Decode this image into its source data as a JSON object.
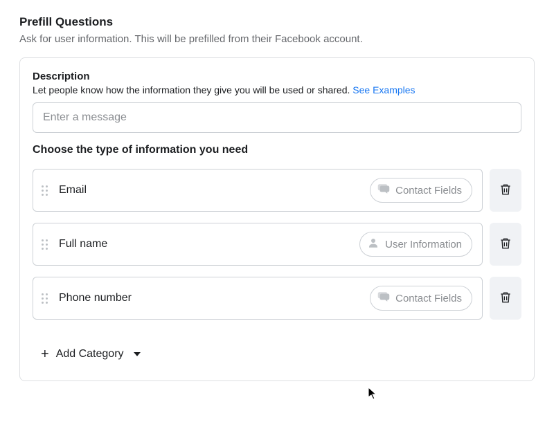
{
  "header": {
    "title": "Prefill Questions",
    "subtitle": "Ask for user information. This will be prefilled from their Facebook account."
  },
  "description": {
    "label": "Description",
    "help": "Let people know how the information they give you will be used or shared.",
    "examples_link": "See Examples",
    "placeholder": "Enter a message",
    "value": ""
  },
  "choose_label": "Choose the type of information you need",
  "fields": [
    {
      "name": "Email",
      "category": "Contact Fields",
      "icon": "speech"
    },
    {
      "name": "Full name",
      "category": "User Information",
      "icon": "user"
    },
    {
      "name": "Phone number",
      "category": "Contact Fields",
      "icon": "speech"
    }
  ],
  "add_category_label": "Add Category"
}
